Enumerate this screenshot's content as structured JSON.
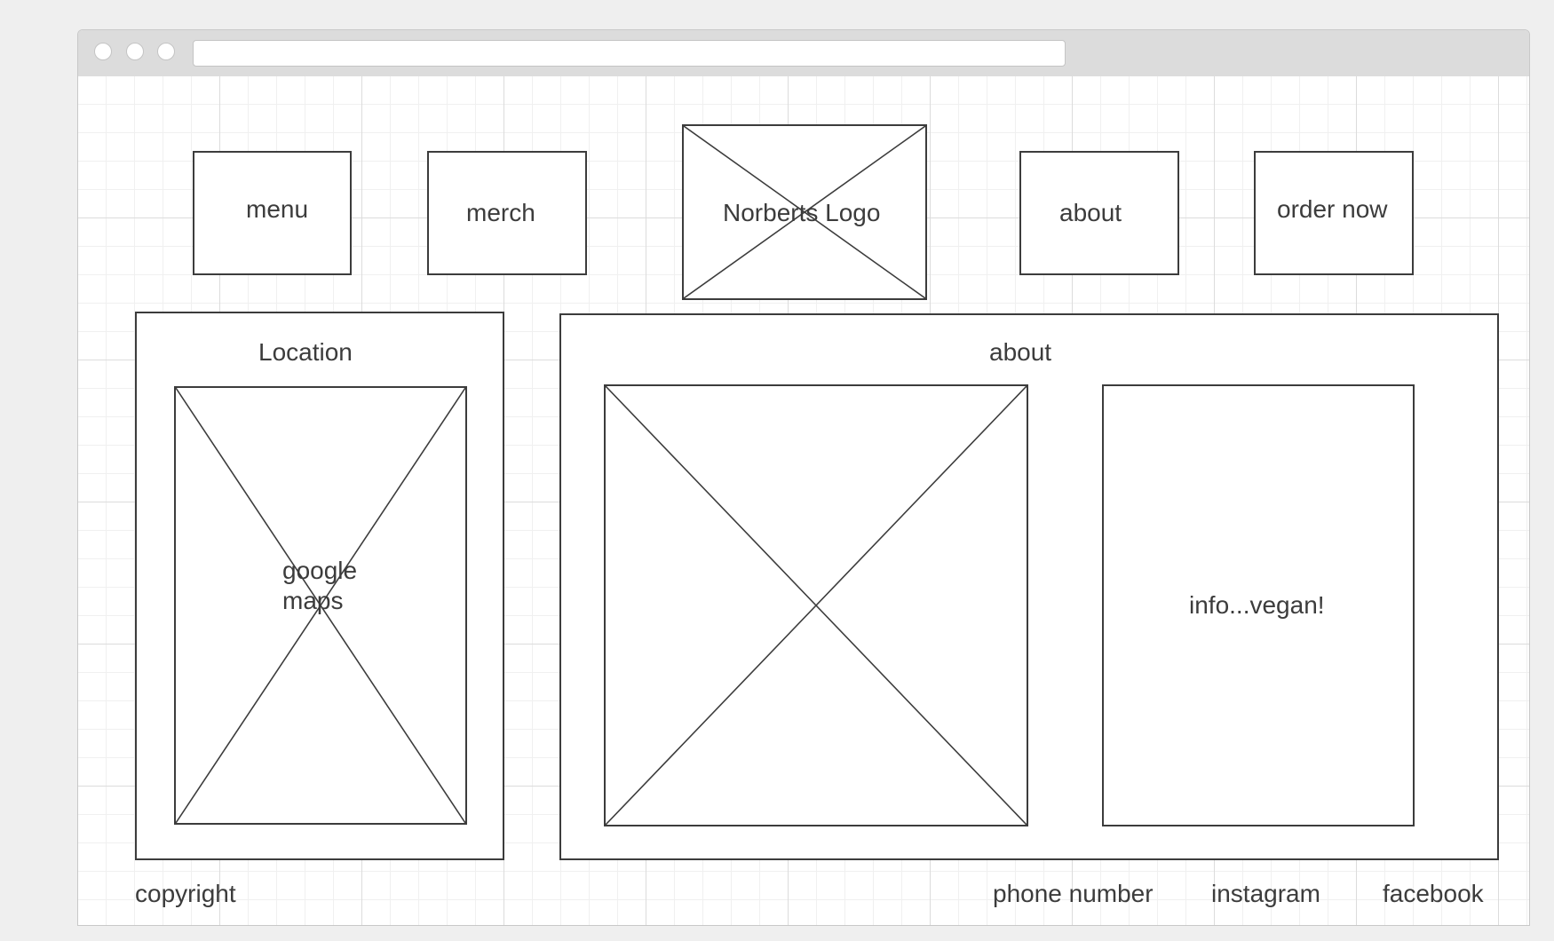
{
  "nav": {
    "menu_label": "menu",
    "merch_label": "merch",
    "logo_label": "Norberts Logo",
    "about_label": "about",
    "order_label": "order now"
  },
  "location_panel": {
    "title": "Location",
    "map_line1": "google",
    "map_line2": "maps"
  },
  "about_panel": {
    "title": "about",
    "info_text": "info...vegan!"
  },
  "footer": {
    "copyright": "copyright",
    "phone": "phone number",
    "instagram": "instagram",
    "facebook": "facebook"
  }
}
